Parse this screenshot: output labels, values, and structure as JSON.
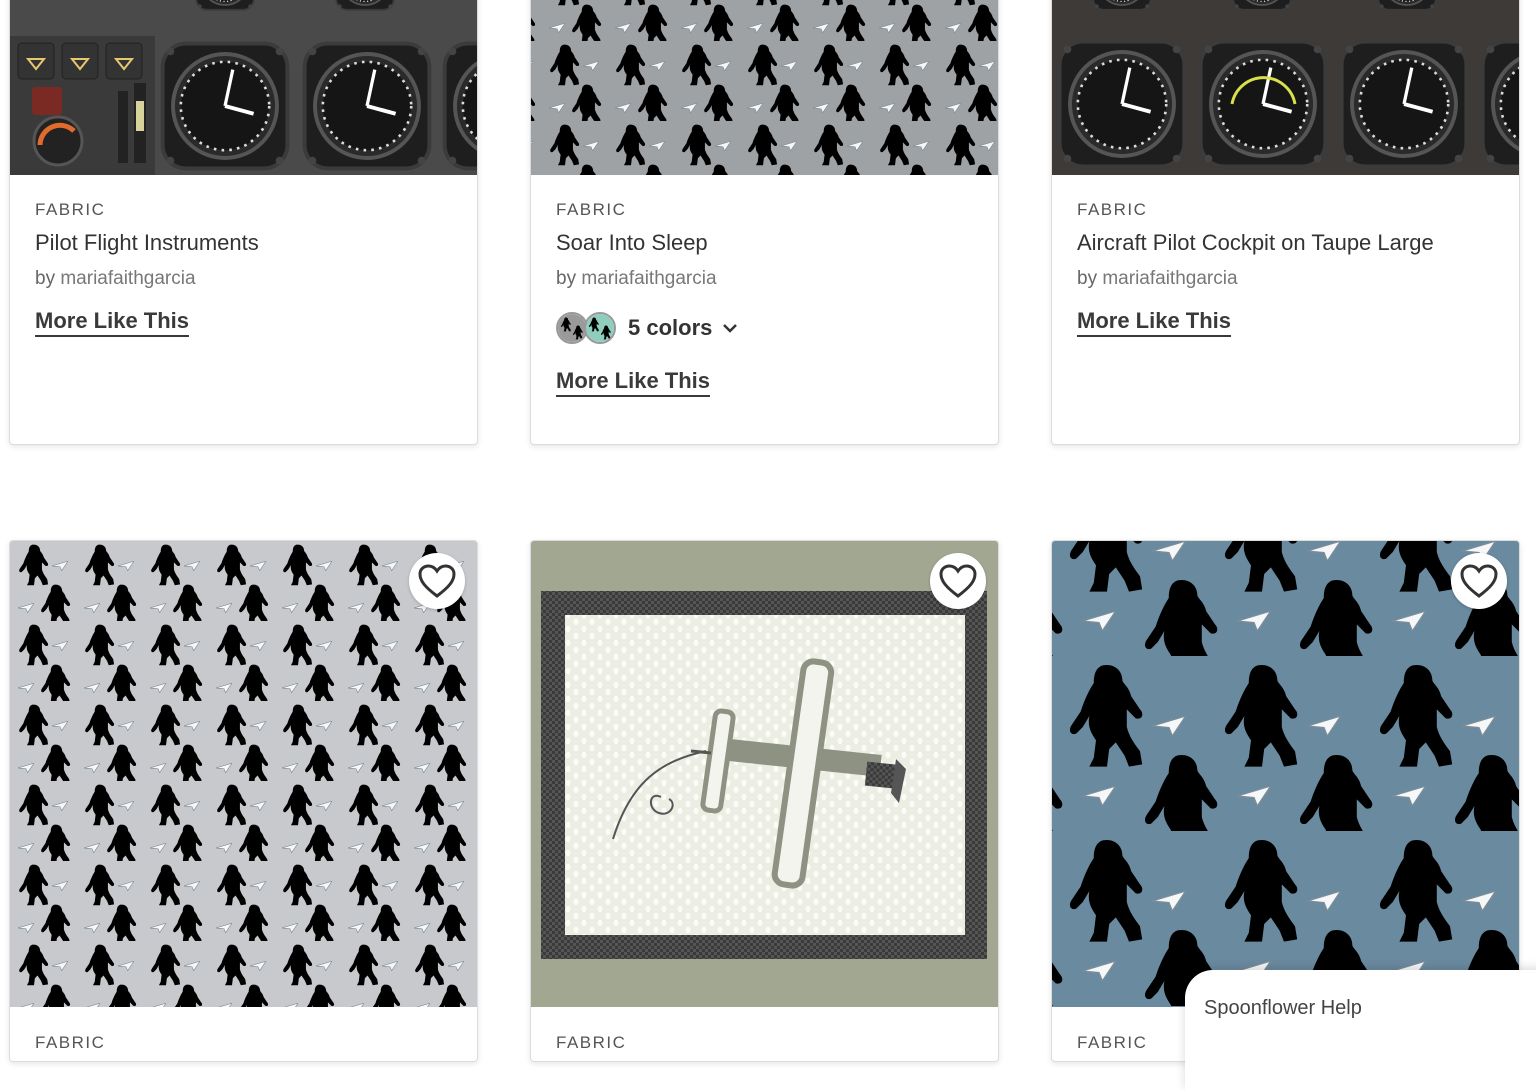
{
  "cards_top": [
    {
      "category": "FABRIC",
      "title": "Pilot Flight Instruments",
      "by": "by",
      "designer": "mariafaithgarcia",
      "more": "More Like This"
    },
    {
      "category": "FABRIC",
      "title": "Soar Into Sleep",
      "by": "by",
      "designer": "mariafaithgarcia",
      "colors": "5 colors",
      "more": "More Like This"
    },
    {
      "category": "FABRIC",
      "title": "Aircraft Pilot Cockpit on Taupe Large",
      "by": "by",
      "designer": "mariafaithgarcia",
      "more": "More Like This"
    }
  ],
  "cards_bottom": [
    {
      "category": "FABRIC",
      "image": "sasquatch-grey-pattern"
    },
    {
      "category": "FABRIC",
      "image": "biplane-panel"
    },
    {
      "category": "FABRIC",
      "image": "sasquatch-blue-pattern"
    }
  ],
  "icons": {
    "favorite": "heart-outline-icon",
    "expand": "chevron-down-icon"
  },
  "colors": {
    "text": "#3a3a3a",
    "blue_bg": "#6a8aa0",
    "grey_bg": "#c8c9cc",
    "olive": "#a2a792"
  },
  "help": {
    "label": "Spoonflower Help"
  }
}
